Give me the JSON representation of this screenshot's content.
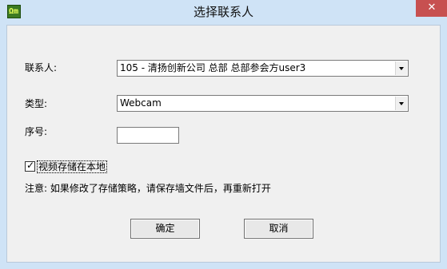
{
  "window": {
    "title": "选择联系人",
    "icon": "app-logo-icon",
    "icon_text": "Ωm",
    "close_symbol": "✕"
  },
  "form": {
    "contact_label": "联系人:",
    "contact_value": "105 - 清扬创新公司 总部 总部参会方user3",
    "type_label": "类型:",
    "type_value": "Webcam",
    "seq_label": "序号:",
    "seq_value": "",
    "save_local_label": "视频存储在本地",
    "save_local_checked": true,
    "checkmark": "✓",
    "note": "注意: 如果修改了存储策略，请保存墙文件后，再重新打开"
  },
  "buttons": {
    "ok": "确定",
    "cancel": "取消"
  },
  "colors": {
    "title_bar": "#cfe3f6",
    "close_button": "#c75050",
    "client_bg": "#f0f0f0"
  }
}
